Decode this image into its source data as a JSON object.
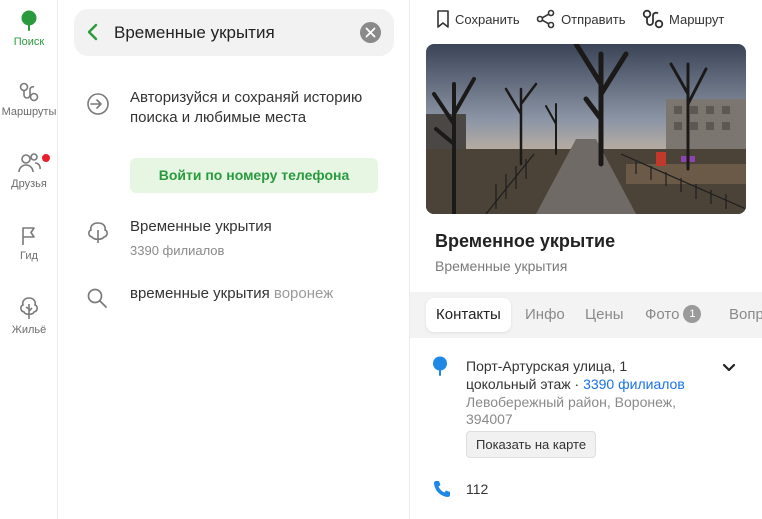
{
  "rail": {
    "search": "Поиск",
    "routes": "Маршруты",
    "friends": "Друзья",
    "guide": "Гид",
    "housing": "Жильё"
  },
  "search": {
    "value": "Временные укрытия"
  },
  "login": {
    "text": "Авторизуйся и сохраняй историю поиска и любимые места",
    "button": "Войти по номеру телефона"
  },
  "suggestions": [
    {
      "title": "Временные укрытия",
      "subtitle": "3390 филиалов"
    },
    {
      "title": "временные укрытия",
      "hint": "воронеж"
    }
  ],
  "actions": {
    "save": "Сохранить",
    "share": "Отправить",
    "route": "Маршрут"
  },
  "place": {
    "title": "Временное укрытие",
    "subtitle": "Временные укрытия"
  },
  "tabs": [
    {
      "label": "Контакты"
    },
    {
      "label": "Инфо"
    },
    {
      "label": "Цены"
    },
    {
      "label": "Фото",
      "count": "1"
    },
    {
      "label": "Вопр"
    }
  ],
  "contacts": {
    "address_line1": "Порт-Артурская улица, 1",
    "address_line2": "цокольный этаж",
    "separator": "·",
    "branches_link": "3390 филиалов",
    "district": "Левобережный район, Воронеж,",
    "postal": "394007",
    "map_button": "Показать на карте",
    "phone": "112"
  },
  "colors": {
    "brand_green": "#2a9a3f",
    "link_blue": "#1a73e8",
    "pin_blue": "#1e88e5",
    "notification_red": "#e8202b"
  }
}
